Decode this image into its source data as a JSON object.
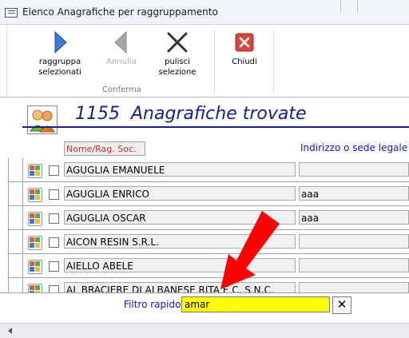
{
  "window": {
    "title": "Elenco Anagrafiche per raggruppamento"
  },
  "ribbon": {
    "raggruppa_label": "raggruppa\nselezionati",
    "annulla_label": "Annulla",
    "pulisci_label": "pulisci\nselezione",
    "chiudi_label": "Chiudi",
    "group_label": "Conferma"
  },
  "header": {
    "count_text": "1155  Anagrafiche trovate",
    "col_nome": "Nome/Rag. Soc.",
    "col_indirizzo": "Indirizzo o sede legale"
  },
  "rows": [
    {
      "name": "AGUGLIA EMANUELE",
      "address": ""
    },
    {
      "name": "AGUGLIA ENRICO",
      "address": "aaa"
    },
    {
      "name": "AGUGLIA OSCAR",
      "address": "aaa"
    },
    {
      "name": "AICON RESIN S.R.L.",
      "address": ""
    },
    {
      "name": "AIELLO ABELE",
      "address": ""
    },
    {
      "name": "AL BRACIERE DI ALBANESE RITA E C. S.N.C.",
      "address": ""
    }
  ],
  "footer": {
    "filtro_label": "Filtro rapido",
    "filtro_value": "amar"
  },
  "colors": {
    "accent_blue": "#16208f",
    "filter_bg": "#ffff00",
    "arrow": "#ff0000"
  }
}
